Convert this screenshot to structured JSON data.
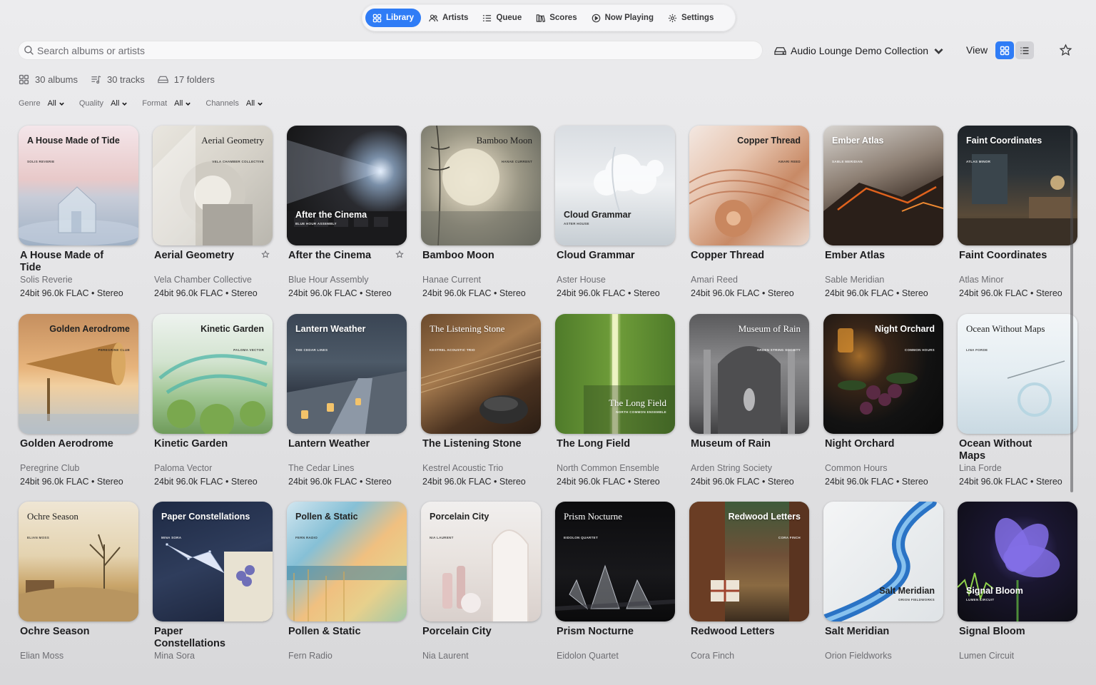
{
  "nav": {
    "items": [
      {
        "label": "Library",
        "icon": "grid-icon",
        "active": true
      },
      {
        "label": "Artists",
        "icon": "people-icon",
        "active": false
      },
      {
        "label": "Queue",
        "icon": "queue-list-icon",
        "active": false
      },
      {
        "label": "Scores",
        "icon": "books-icon",
        "active": false
      },
      {
        "label": "Now Playing",
        "icon": "play-circle-icon",
        "active": false
      },
      {
        "label": "Settings",
        "icon": "gear-icon",
        "active": false
      }
    ]
  },
  "search": {
    "placeholder": "Search albums or artists",
    "value": ""
  },
  "collection": {
    "label": "Audio Lounge Demo Collection"
  },
  "view": {
    "label": "View",
    "mode": "grid"
  },
  "stats": {
    "albums": "30 albums",
    "tracks": "30 tracks",
    "folders": "17 folders"
  },
  "filters": [
    {
      "label": "Genre",
      "value": "All"
    },
    {
      "label": "Quality",
      "value": "All"
    },
    {
      "label": "Format",
      "value": "All"
    },
    {
      "label": "Channels",
      "value": "All"
    }
  ],
  "colors": {
    "accent": "#2f7cf6"
  },
  "albums": [
    {
      "title": "A House Made of Tide",
      "artist": "Solis Reverie",
      "meta": "24bit 96.0k FLAC • Stereo",
      "cover_title": "A House Made of Tide",
      "cover_sub": "SOLIS REVERIE"
    },
    {
      "title": "Aerial Geometry",
      "artist": "Vela Chamber Collective",
      "meta": "24bit 96.0k FLAC • Stereo",
      "starred": true,
      "cover_title": "Aerial Geometry",
      "cover_sub": "VELA CHAMBER COLLECTIVE"
    },
    {
      "title": "After the Cinema",
      "artist": "Blue Hour Assembly",
      "meta": "24bit 96.0k FLAC • Stereo",
      "starred": true,
      "cover_title": "After the Cinema",
      "cover_sub": "BLUE HOUR ASSEMBLY"
    },
    {
      "title": "Bamboo Moon",
      "artist": "Hanae Current",
      "meta": "24bit 96.0k FLAC • Stereo",
      "cover_title": "Bamboo Moon",
      "cover_sub": "HANAE CURRENT"
    },
    {
      "title": "Cloud Grammar",
      "artist": "Aster House",
      "meta": "24bit 96.0k FLAC • Stereo",
      "cover_title": "Cloud Grammar",
      "cover_sub": "ASTER HOUSE"
    },
    {
      "title": "Copper Thread",
      "artist": "Amari Reed",
      "meta": "24bit 96.0k FLAC • Stereo",
      "cover_title": "Copper Thread",
      "cover_sub": "AMARI REED"
    },
    {
      "title": "Ember Atlas",
      "artist": "Sable Meridian",
      "meta": "24bit 96.0k FLAC • Stereo",
      "cover_title": "Ember Atlas",
      "cover_sub": "SABLE MERIDIAN"
    },
    {
      "title": "Faint Coordinates",
      "artist": "Atlas Minor",
      "meta": "24bit 96.0k FLAC • Stereo",
      "cover_title": "Faint Coordinates",
      "cover_sub": "ATLAS MINOR"
    },
    {
      "title": "Golden Aerodrome",
      "artist": "Peregrine Club",
      "meta": "24bit 96.0k FLAC • Stereo",
      "cover_title": "Golden Aerodrome",
      "cover_sub": "PEREGRINE CLUB"
    },
    {
      "title": "Kinetic Garden",
      "artist": "Paloma Vector",
      "meta": "24bit 96.0k FLAC • Stereo",
      "cover_title": "Kinetic Garden",
      "cover_sub": "PALOMA VECTOR"
    },
    {
      "title": "Lantern Weather",
      "artist": "The Cedar Lines",
      "meta": "24bit 96.0k FLAC • Stereo",
      "cover_title": "Lantern Weather",
      "cover_sub": "THE CEDAR LINES"
    },
    {
      "title": "The Listening Stone",
      "artist": "Kestrel Acoustic Trio",
      "meta": "24bit 96.0k FLAC • Stereo",
      "cover_title": "The Listening Stone",
      "cover_sub": "KESTREL ACOUSTIC TRIO"
    },
    {
      "title": "The Long Field",
      "artist": "North Common Ensemble",
      "meta": "24bit 96.0k FLAC • Stereo",
      "cover_title": "The Long Field",
      "cover_sub": "NORTH COMMON ENSEMBLE"
    },
    {
      "title": "Museum of Rain",
      "artist": "Arden String Society",
      "meta": "24bit 96.0k FLAC • Stereo",
      "cover_title": "Museum of Rain",
      "cover_sub": "ARDEN STRING SOCIETY"
    },
    {
      "title": "Night Orchard",
      "artist": "Common Hours",
      "meta": "24bit 96.0k FLAC • Stereo",
      "cover_title": "Night Orchard",
      "cover_sub": "COMMON HOURS"
    },
    {
      "title": "Ocean Without Maps",
      "artist": "Lina Forde",
      "meta": "24bit 96.0k FLAC • Stereo",
      "cover_title": "Ocean Without Maps",
      "cover_sub": "LINA FORDE"
    },
    {
      "title": "Ochre Season",
      "artist": "Elian Moss",
      "meta": "",
      "cover_title": "Ochre Season",
      "cover_sub": "ELIAN MOSS"
    },
    {
      "title": "Paper Constellations",
      "artist": "Mina Sora",
      "meta": "",
      "cover_title": "Paper Constellations",
      "cover_sub": "MINA SORA"
    },
    {
      "title": "Pollen & Static",
      "artist": "Fern Radio",
      "meta": "",
      "cover_title": "Pollen & Static",
      "cover_sub": "FERN RADIO"
    },
    {
      "title": "Porcelain City",
      "artist": "Nia Laurent",
      "meta": "",
      "cover_title": "Porcelain City",
      "cover_sub": "NIA LAURENT"
    },
    {
      "title": "Prism Nocturne",
      "artist": "Eidolon Quartet",
      "meta": "",
      "cover_title": "Prism Nocturne",
      "cover_sub": "EIDOLON QUARTET"
    },
    {
      "title": "Redwood Letters",
      "artist": "Cora Finch",
      "meta": "",
      "cover_title": "Redwood Letters",
      "cover_sub": "CORA FINCH"
    },
    {
      "title": "Salt Meridian",
      "artist": "Orion Fieldworks",
      "meta": "",
      "cover_title": "Salt Meridian",
      "cover_sub": "ORION FIELDWORKS"
    },
    {
      "title": "Signal Bloom",
      "artist": "Lumen Circuit",
      "meta": "",
      "cover_title": "Signal Bloom",
      "cover_sub": "LUMEN CIRCUIT"
    }
  ]
}
